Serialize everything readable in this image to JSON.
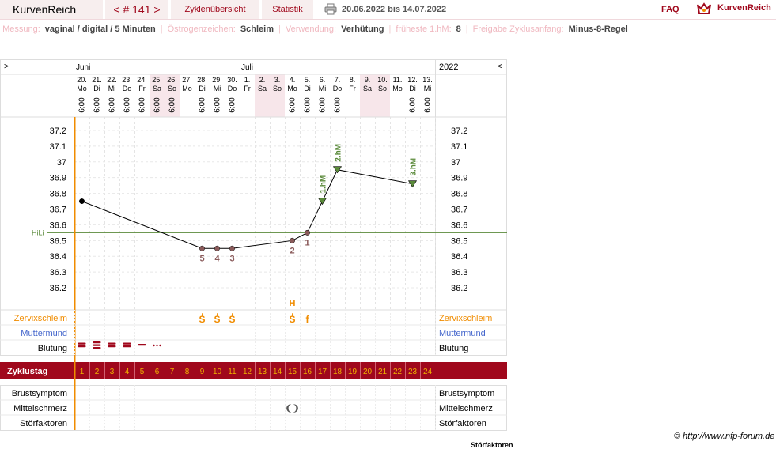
{
  "header": {
    "app_title": "KurvenReich",
    "cycle_nav": "< # 141 >",
    "overview_tab": "Zyklenübersicht",
    "stats_tab": "Statistik",
    "date_range": "20.06.2022 bis 14.07.2022",
    "faq": "FAQ",
    "logo_text": "KurvenReich"
  },
  "info": {
    "measurement_label": "Messung:",
    "measurement_value": "vaginal / digital / 5 Minuten",
    "estrogen_label": "Östrogenzeichen:",
    "estrogen_value": "Schleim",
    "usage_label": "Verwendung:",
    "usage_value": "Verhütung",
    "earliest_label": "früheste 1.hM:",
    "earliest_value": "8",
    "release_label": "Freigabe Zyklusanfang:",
    "release_value": "Minus-8-Regel"
  },
  "chart_data": {
    "type": "line",
    "nav_prev": ">",
    "nav_next": "<",
    "year": "2022",
    "month_labels": [
      {
        "col": 0,
        "text": "Juni"
      },
      {
        "col": 11,
        "text": "Juli"
      }
    ],
    "dates": [
      "20.",
      "21.",
      "22.",
      "23.",
      "24.",
      "25.",
      "26.",
      "27.",
      "28.",
      "29.",
      "30.",
      "1.",
      "2.",
      "3.",
      "4.",
      "5.",
      "6.",
      "7.",
      "8.",
      "9.",
      "10.",
      "11.",
      "12.",
      "13."
    ],
    "weekdays": [
      "Mo",
      "Di",
      "Mi",
      "Do",
      "Fr",
      "Sa",
      "So",
      "Mo",
      "Di",
      "Mi",
      "Do",
      "Fr",
      "Sa",
      "So",
      "Mo",
      "Di",
      "Mi",
      "Do",
      "Fr",
      "Sa",
      "So",
      "Mo",
      "Di",
      "Mi"
    ],
    "weekend_cols": [
      5,
      6,
      12,
      13,
      19,
      20
    ],
    "times": [
      "6:00",
      "6:00",
      "6:00",
      "6:00",
      "6:00",
      "6:00",
      "6:00",
      "",
      "6:00",
      "6:00",
      "6:00",
      "",
      "",
      "",
      "6:00",
      "6:00",
      "6:00",
      "6:00",
      "",
      "",
      "",
      "",
      "6:00",
      "6:00"
    ],
    "y_ticks": [
      "37.2",
      "37.1",
      "37",
      "36.9",
      "36.8",
      "36.7",
      "36.6",
      "36.5",
      "36.4",
      "36.3",
      "36.2"
    ],
    "ylim": [
      36.15,
      37.25
    ],
    "hili_label": "HiLi",
    "hili_value": 36.55,
    "temperatures": [
      {
        "day": 1,
        "value": 36.75
      },
      {
        "day": 9,
        "value": 36.45
      },
      {
        "day": 10,
        "value": 36.45
      },
      {
        "day": 11,
        "value": 36.45
      },
      {
        "day": 15,
        "value": 36.5
      },
      {
        "day": 16,
        "value": 36.55
      },
      {
        "day": 17,
        "value": 36.75
      },
      {
        "day": 18,
        "value": 36.95
      },
      {
        "day": 23,
        "value": 36.86
      }
    ],
    "low_labels": [
      {
        "day": 9,
        "text": "5"
      },
      {
        "day": 10,
        "text": "4"
      },
      {
        "day": 11,
        "text": "3"
      },
      {
        "day": 15,
        "text": "2"
      },
      {
        "day": 16,
        "text": "1"
      }
    ],
    "high_labels": [
      {
        "day": 17,
        "text": "1.hM"
      },
      {
        "day": 18,
        "text": "2.hM"
      },
      {
        "day": 23,
        "text": "3.hM"
      }
    ],
    "mucus": [
      {
        "day": 9,
        "text": "S",
        "mark": "+"
      },
      {
        "day": 10,
        "text": "S",
        "mark": "+"
      },
      {
        "day": 11,
        "text": "S",
        "mark": "+"
      },
      {
        "day": 15,
        "text": "S",
        "mark": "+",
        "top": "H"
      },
      {
        "day": 16,
        "text": "f",
        "mark": ""
      }
    ],
    "bleeding": [
      {
        "day": 1,
        "level": 2
      },
      {
        "day": 2,
        "level": 3
      },
      {
        "day": 3,
        "level": 2
      },
      {
        "day": 4,
        "level": 2
      },
      {
        "day": 5,
        "level": 1
      },
      {
        "day": 6,
        "level": 0
      }
    ],
    "pain_mark": {
      "day": 15,
      "text": "❨❩"
    },
    "rows_left": {
      "mucus": "Zervixschleim",
      "cervix": "Muttermund",
      "bleeding": "Blutung",
      "cycle_day": "Zyklustag",
      "breast": "Brustsymptom",
      "mittel": "Mittelschmerz",
      "stoer": "Störfaktoren"
    },
    "cycle_days": [
      "1",
      "2",
      "3",
      "4",
      "5",
      "6",
      "7",
      "8",
      "9",
      "10",
      "11",
      "12",
      "13",
      "14",
      "15",
      "16",
      "17",
      "18",
      "19",
      "20",
      "21",
      "22",
      "23",
      "24"
    ]
  },
  "footer": {
    "credit": "© http://www.nfp-forum.de",
    "fragment": "Störfaktoren"
  },
  "colors": {
    "accent": "#a0081c",
    "orange": "#f08c00",
    "green": "#5a8a3a",
    "blue": "#4466cc",
    "low": "#8a5a5a"
  }
}
